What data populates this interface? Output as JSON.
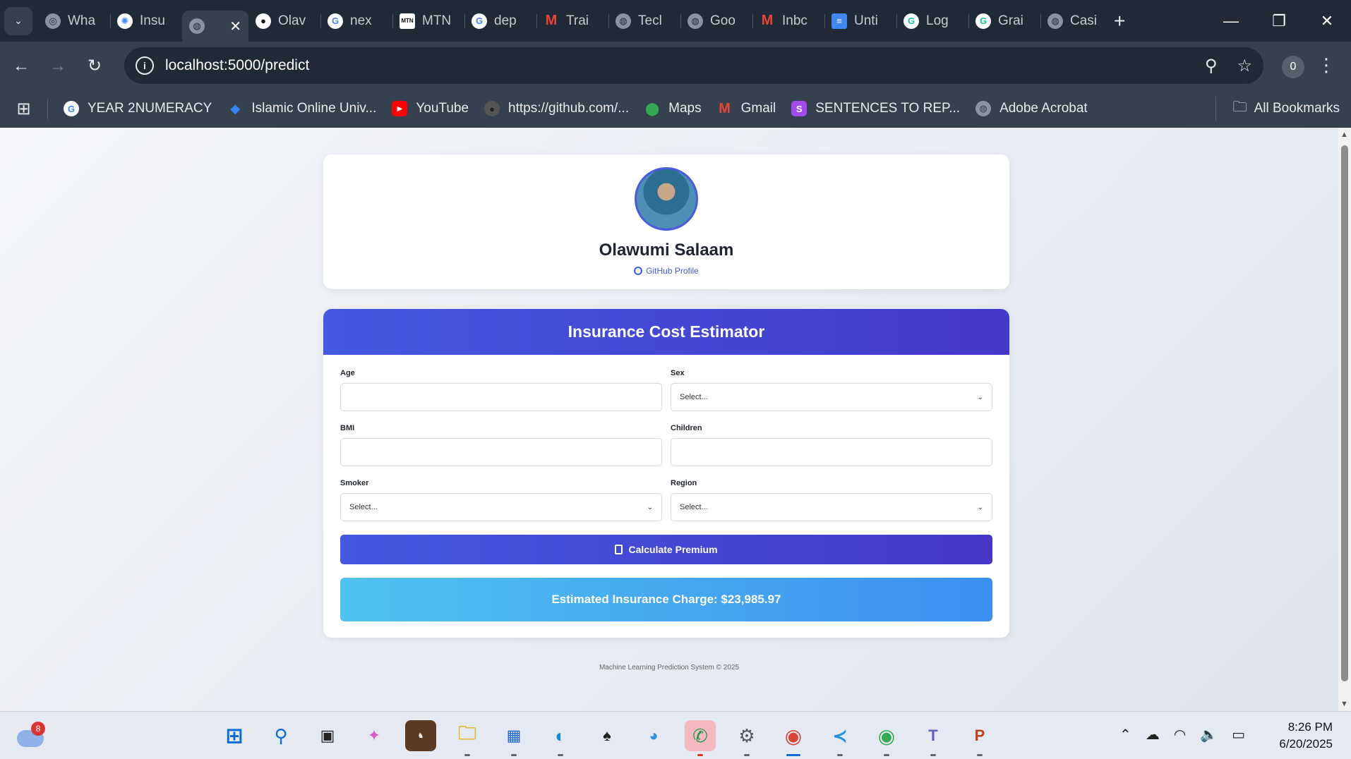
{
  "browser": {
    "tabs": [
      {
        "label": "Wha",
        "icon": "chrome-icon"
      },
      {
        "label": "Insu",
        "icon": "openai-icon"
      },
      {
        "label": "",
        "icon": "globe-icon",
        "active": true
      },
      {
        "label": "Olav",
        "icon": "github-icon"
      },
      {
        "label": "nex",
        "icon": "google-icon"
      },
      {
        "label": "MTN",
        "icon": "mtn-icon"
      },
      {
        "label": "dep",
        "icon": "google-icon"
      },
      {
        "label": "Trai",
        "icon": "gmail-icon"
      },
      {
        "label": "Tecl",
        "icon": "globe-icon"
      },
      {
        "label": "Goo",
        "icon": "globe-icon"
      },
      {
        "label": "Inbc",
        "icon": "gmail-icon"
      },
      {
        "label": "Unti",
        "icon": "docs-icon"
      },
      {
        "label": "Log",
        "icon": "grammarly-icon"
      },
      {
        "label": "Grai",
        "icon": "grammarly-icon"
      },
      {
        "label": "Casi",
        "icon": "globe-icon"
      }
    ],
    "url": "localhost:5000/predict",
    "profile_badge": "0",
    "bookmarks": [
      {
        "label": "YEAR 2NUMERACY",
        "icon": "google-icon"
      },
      {
        "label": "Islamic Online Univ...",
        "icon": "diamond-icon"
      },
      {
        "label": "YouTube",
        "icon": "youtube-icon"
      },
      {
        "label": "https://github.com/...",
        "icon": "github-icon"
      },
      {
        "label": "Maps",
        "icon": "maps-icon"
      },
      {
        "label": "Gmail",
        "icon": "gmail-icon"
      },
      {
        "label": "SENTENCES TO REP...",
        "icon": "canva-icon"
      },
      {
        "label": "Adobe Acrobat",
        "icon": "globe-icon"
      }
    ],
    "all_bookmarks": "All Bookmarks"
  },
  "profile": {
    "name": "Olawumi Salaam",
    "link": "GitHub Profile"
  },
  "form": {
    "title": "Insurance Cost Estimator",
    "fields": {
      "age": {
        "label": "Age",
        "value": ""
      },
      "sex": {
        "label": "Sex",
        "value": "Select..."
      },
      "bmi": {
        "label": "BMI",
        "value": ""
      },
      "children": {
        "label": "Children",
        "value": ""
      },
      "smoker": {
        "label": "Smoker",
        "value": "Select..."
      },
      "region": {
        "label": "Region",
        "value": "Select..."
      }
    },
    "submit": "Calculate Premium",
    "result": "Estimated Insurance Charge: $23,985.97"
  },
  "footer": "Machine Learning Prediction System © 2025",
  "taskbar": {
    "weather_badge": "8",
    "time": "8:26 PM",
    "date": "6/20/2025"
  },
  "colors": {
    "accent": "#4458e0",
    "result": "#3b8ff0"
  }
}
